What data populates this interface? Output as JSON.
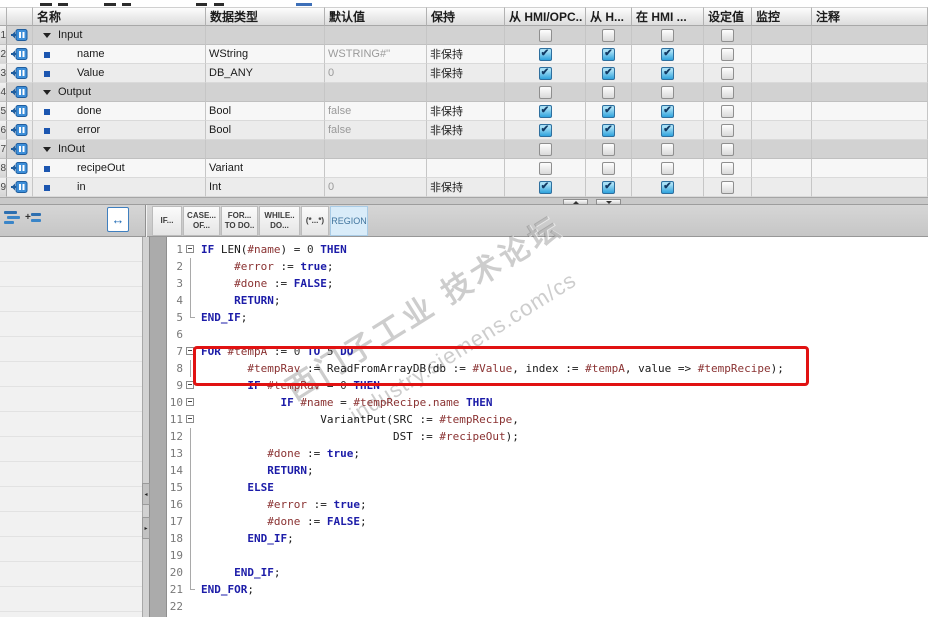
{
  "interface_table": {
    "headers": [
      "名称",
      "数据类型",
      "默认值",
      "保持",
      "从 HMI/OPC..",
      "从 H...",
      "在 HMI ...",
      "设定值",
      "监控",
      "注释"
    ],
    "retain_value": "非保持",
    "rows": [
      {
        "num": "1",
        "kind": "group",
        "name": "Input",
        "data_type": "",
        "default": "",
        "retain": "",
        "checks": [
          false,
          false,
          false,
          false
        ]
      },
      {
        "num": "2",
        "kind": "child",
        "name": "name",
        "data_type": "WString",
        "default": "WSTRING#''",
        "retain": "非保持",
        "checks": [
          true,
          true,
          true,
          false
        ]
      },
      {
        "num": "3",
        "kind": "child",
        "name": "Value",
        "data_type": "DB_ANY",
        "default": "0",
        "retain": "非保持",
        "checks": [
          true,
          true,
          true,
          false
        ]
      },
      {
        "num": "4",
        "kind": "group",
        "name": "Output",
        "data_type": "",
        "default": "",
        "retain": "",
        "checks": [
          false,
          false,
          false,
          false
        ]
      },
      {
        "num": "5",
        "kind": "child",
        "name": "done",
        "data_type": "Bool",
        "default": "false",
        "retain": "非保持",
        "checks": [
          true,
          true,
          true,
          false
        ]
      },
      {
        "num": "6",
        "kind": "child",
        "name": "error",
        "data_type": "Bool",
        "default": "false",
        "retain": "非保持",
        "checks": [
          true,
          true,
          true,
          false
        ]
      },
      {
        "num": "7",
        "kind": "group",
        "name": "InOut",
        "data_type": "",
        "default": "",
        "retain": "",
        "checks": [
          false,
          false,
          false,
          false
        ]
      },
      {
        "num": "8",
        "kind": "child",
        "name": "recipeOut",
        "data_type": "Variant",
        "default": "",
        "retain": "",
        "checks": [
          false,
          false,
          false,
          false
        ]
      },
      {
        "num": "9",
        "kind": "child",
        "name": "in",
        "data_type": "Int",
        "default": "0",
        "retain": "非保持",
        "checks": [
          true,
          true,
          true,
          false
        ]
      }
    ]
  },
  "snippet_toolbar": {
    "buttons": [
      {
        "line1": "IF...",
        "line2": ""
      },
      {
        "line1": "CASE...",
        "line2": "OF..."
      },
      {
        "line1": "FOR...",
        "line2": "TO DO.."
      },
      {
        "line1": "WHILE..",
        "line2": "DO..."
      },
      {
        "line1": "(*...*)",
        "line2": ""
      },
      {
        "line1": "REGION",
        "line2": ""
      }
    ]
  },
  "editor": {
    "lines": [
      {
        "n": "1",
        "fold": "box",
        "text": "IF LEN(#name) = 0 THEN"
      },
      {
        "n": "2",
        "fold": "vline",
        "text": "     #error := true;"
      },
      {
        "n": "3",
        "fold": "vline",
        "text": "     #done := FALSE;"
      },
      {
        "n": "4",
        "fold": "vline",
        "text": "     RETURN;"
      },
      {
        "n": "5",
        "fold": "end",
        "text": "END_IF;"
      },
      {
        "n": "6",
        "fold": "none",
        "text": ""
      },
      {
        "n": "7",
        "fold": "box",
        "text": "FOR #tempA := 0 TO 5 DO"
      },
      {
        "n": "8",
        "fold": "vline",
        "text": "       #tempRav := ReadFromArrayDB(db := #Value, index := #tempA, value => #tempRecipe);"
      },
      {
        "n": "9",
        "fold": "box",
        "text": "       IF #tempRav = 0 THEN"
      },
      {
        "n": "10",
        "fold": "box",
        "text": "            IF #name = #tempRecipe.name THEN"
      },
      {
        "n": "11",
        "fold": "box",
        "text": "                  VariantPut(SRC := #tempRecipe,"
      },
      {
        "n": "12",
        "fold": "vline",
        "text": "                             DST := #recipeOut);"
      },
      {
        "n": "13",
        "fold": "vline",
        "text": "          #done := true;"
      },
      {
        "n": "14",
        "fold": "vline",
        "text": "          RETURN;"
      },
      {
        "n": "15",
        "fold": "vline",
        "text": "       ELSE"
      },
      {
        "n": "16",
        "fold": "vline",
        "text": "          #error := true;"
      },
      {
        "n": "17",
        "fold": "vline",
        "text": "          #done := FALSE;"
      },
      {
        "n": "18",
        "fold": "vline",
        "text": "       END_IF;"
      },
      {
        "n": "19",
        "fold": "vline",
        "text": ""
      },
      {
        "n": "20",
        "fold": "vline",
        "text": "     END_IF;"
      },
      {
        "n": "21",
        "fold": "end",
        "text": "END_FOR;"
      },
      {
        "n": "22",
        "fold": "none",
        "text": ""
      }
    ]
  },
  "watermark": {
    "line1": "西门子工业 技术论坛",
    "line2": "industry.siemens.com/cs"
  },
  "colors": {
    "annotation_red": "#e11212",
    "checkbox_blue": "#2fa2dc",
    "keyword_blue": "#1c1ca8",
    "variable_maroon": "#8a3232",
    "param_icon_blue": "#3d8ed8",
    "region_button_bg": "#d9ecf9"
  }
}
